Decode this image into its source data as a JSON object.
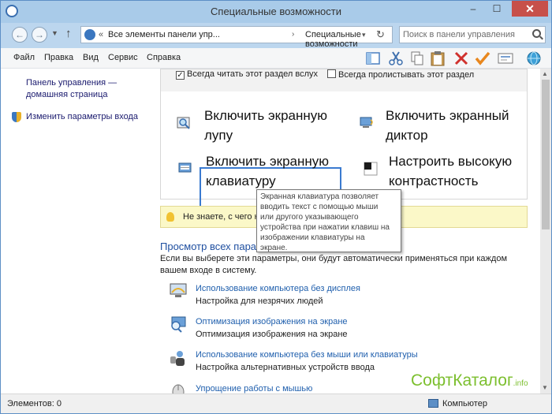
{
  "window": {
    "title": "Специальные возможности",
    "min_glyph": "–",
    "max_glyph": "☐",
    "close_glyph": "✕"
  },
  "nav": {
    "back_glyph": "←",
    "forward_glyph": "→",
    "dropdown_glyph": "▼",
    "up_glyph": "↑",
    "address_chevron": "«",
    "breadcrumb_1": "Все элементы панели упр...",
    "breadcrumb_sep": "›",
    "breadcrumb_2": "Специальные возможности",
    "address_dropdown_glyph": "▾",
    "refresh_glyph": "↻",
    "search_placeholder": "Поиск в панели управления"
  },
  "menu": [
    "Файл",
    "Правка",
    "Вид",
    "Сервис",
    "Справка"
  ],
  "toolbar_icons": [
    "layout-icon",
    "cut-icon",
    "copy-icon",
    "paste-icon",
    "delete-icon",
    "check-icon",
    "properties-icon",
    "globe-icon"
  ],
  "sidebar": {
    "home_link_line1": "Панель управления —",
    "home_link_line2": "домашняя страница",
    "signin_link": "Изменить параметры входа"
  },
  "quick_access": {
    "checkbox_read": "Всегда читать этот раздел вслух",
    "checkbox_read_checked": true,
    "checkbox_scan": "Всегда пролистывать этот раздел",
    "checkbox_scan_checked": false,
    "magnifier_l1": "Включить экранную",
    "magnifier_l2": "лупу",
    "narrator_l1": "Включить экранный",
    "narrator_l2": "диктор",
    "keyboard_l1": "Включить экранную",
    "keyboard_l2": "клавиатуру",
    "contrast_l1": "Настроить высокую",
    "contrast_l2": "контрастность"
  },
  "tooltip": {
    "l1": "Экранная клавиатура позволяет",
    "l2": "вводить текст с помощью мыши",
    "l3": "или другого указывающего",
    "l4": "устройства при нажатии клавиш на",
    "l5": "изображении клавиатуры на",
    "l6": "экране."
  },
  "hint": {
    "text": "Не знаете, с чего на",
    "link": "с"
  },
  "section": {
    "title": "Просмотр всех пара",
    "desc": "Если вы выберете эти параметры, они будут автоматически применяться при каждом вашем входе в систему."
  },
  "options": [
    {
      "link": "Использование компьютера без дисплея",
      "desc": "Настройка для незрячих людей"
    },
    {
      "link": "Оптимизация изображения на экране",
      "desc": "Оптимизация изображения на экране"
    },
    {
      "link": "Использование компьютера без мыши или клавиатуры",
      "desc": "Настройка альтернативных устройств ввода"
    },
    {
      "link": "Упрощение работы с мышью",
      "desc": ""
    }
  ],
  "status": {
    "items": "Элементов: 0",
    "location": "Компьютер"
  },
  "watermark": {
    "text": "СофтКаталог",
    "suffix": ".info"
  }
}
